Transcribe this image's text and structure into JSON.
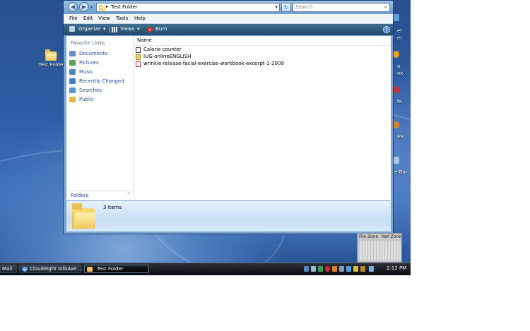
{
  "window": {
    "address_path": "Test Folder",
    "search_placeholder": "Search"
  },
  "menu": [
    "File",
    "Edit",
    "View",
    "Tools",
    "Help"
  ],
  "toolbar": {
    "organize": "Organize",
    "views": "Views",
    "burn": "Burn"
  },
  "sidebar": {
    "title": "Favorite Links",
    "items": [
      {
        "label": "Documents",
        "icon": "documents-icon",
        "color": "#6b8cc8"
      },
      {
        "label": "Pictures",
        "icon": "pictures-icon",
        "color": "#5aa05a"
      },
      {
        "label": "Music",
        "icon": "music-icon",
        "color": "#4f86c6"
      },
      {
        "label": "Recently Changed",
        "icon": "recent-icon",
        "color": "#3f7fc0"
      },
      {
        "label": "Searches",
        "icon": "searches-icon",
        "color": "#5a93d2"
      },
      {
        "label": "Public",
        "icon": "public-folder-icon",
        "color": "#e0b83c"
      }
    ],
    "folders_label": "Folders"
  },
  "filelist": {
    "column_name": "Name",
    "files": [
      {
        "name": "Calorie counter",
        "icon": "shortcut-icon"
      },
      {
        "name": "IUG-onlineENGLISH",
        "icon": "zip-icon"
      },
      {
        "name": "wrinkle-release-facial-exercise-workbook-excerpt-1-2009",
        "icon": "pdf-icon"
      }
    ]
  },
  "details": {
    "item_count": "3 items"
  },
  "desktop": {
    "folder_label": "Test Folde",
    "right_labels": [
      "et",
      "er",
      "a",
      "ox",
      "ts",
      "ES",
      "e Bin"
    ]
  },
  "gadget": {
    "label_left": "File Zone",
    "label_right": "Net Zone"
  },
  "taskbar": {
    "items": [
      {
        "label": "Mail",
        "active": false
      },
      {
        "label": "Cloudeight InfoAve ...",
        "active": false
      },
      {
        "label": "Test Folder",
        "active": true
      }
    ],
    "clock": "2:12 PM"
  },
  "colors": {
    "accent_link": "#1f4e9a",
    "toolbar": "#2e5a7e"
  }
}
